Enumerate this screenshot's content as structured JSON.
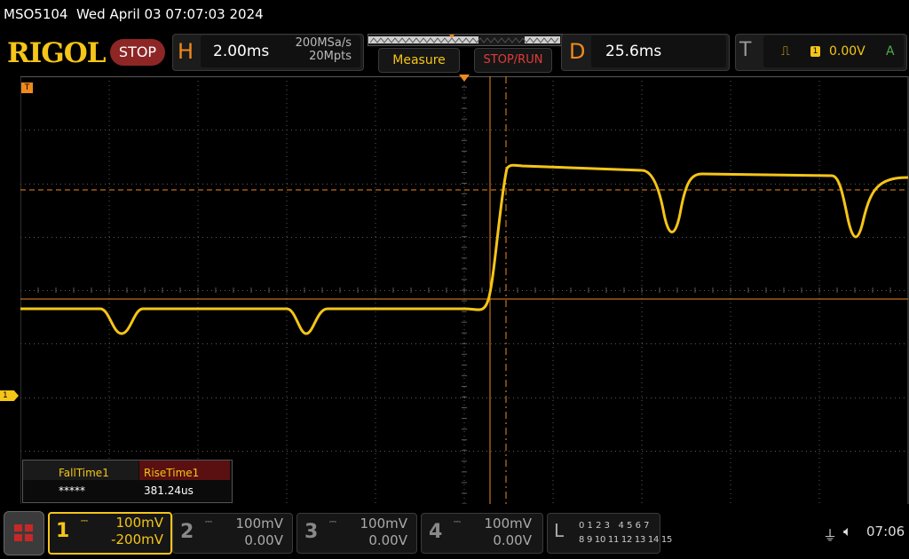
{
  "title_bar": {
    "text": "MSO5104  Wed April 03 07:07:03 2024"
  },
  "brand": {
    "logo": "RIGOL",
    "status": "STOP"
  },
  "horizontal": {
    "letter": "H",
    "timebase": "2.00ms",
    "sample_rate": "200MSa/s",
    "memory_depth": "20Mpts"
  },
  "toolbar": {
    "measure_label": "Measure",
    "stoprun_label": "STOP/RUN"
  },
  "delay": {
    "letter": "D",
    "value": "25.6ms"
  },
  "trigger": {
    "letter": "T",
    "edge_icon": "rising-edge-icon",
    "source": "1",
    "level": "0.00V",
    "mode": "A"
  },
  "markers": {
    "trigger_marker": "T",
    "ch1_marker": "1"
  },
  "measurements": {
    "headers": [
      "FallTime1",
      "RiseTime1"
    ],
    "values": [
      "*****",
      "381.24us"
    ]
  },
  "channels": [
    {
      "num": "1",
      "scale": "100mV",
      "offset": "-200mV",
      "color": "#f5c518",
      "active": true
    },
    {
      "num": "2",
      "scale": "100mV",
      "offset": "0.00V",
      "color": "#888888",
      "active": false
    },
    {
      "num": "3",
      "scale": "100mV",
      "offset": "0.00V",
      "color": "#888888",
      "active": false
    },
    {
      "num": "4",
      "scale": "100mV",
      "offset": "0.00V",
      "color": "#888888",
      "active": false
    }
  ],
  "logic": {
    "letter": "L",
    "row1": "0 1 2 3   4 5 6 7",
    "row2": "8 9 10 11 12 13 14 15"
  },
  "status": {
    "usb_icon": "usb-icon",
    "speaker_icon": "speaker-muted-icon",
    "clock": "07:06"
  },
  "colors": {
    "trace": "#f5c518",
    "cursor": "#f08a1c",
    "grid": "#5a5a5a",
    "accent": "#f08a1c"
  }
}
